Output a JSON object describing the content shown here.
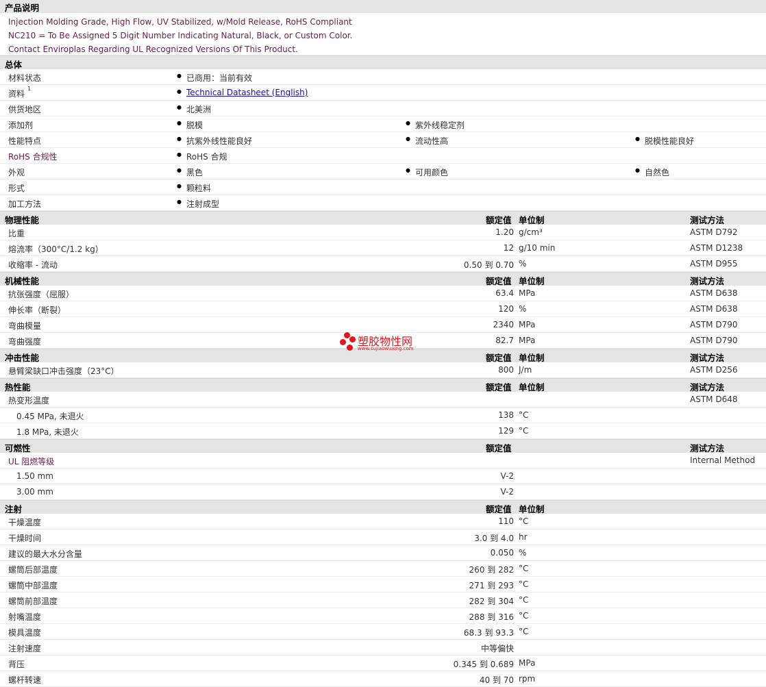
{
  "description": {
    "title": "产品说明",
    "lines": [
      "Injection Molding Grade, High Flow, UV Stabilized, w/Mold Release, RoHS Compliant",
      "NC210 = To Be Assigned 5 Digit Number Indicating Natural, Black, or Custom Color.",
      "Contact Enviroplas Regarding UL Recognized Versions Of This Product."
    ]
  },
  "general": {
    "title": "总体",
    "rows": [
      {
        "label": "材料状态",
        "v1": "已商用：当前有效"
      },
      {
        "label": "资料",
        "sup": "1",
        "v1": "Technical Datasheet (English)"
      },
      {
        "label": "供货地区",
        "v1": "北美洲"
      },
      {
        "label": "添加剂",
        "v1": "脱模",
        "v2": "紫外线稳定剂"
      },
      {
        "label": "性能特点",
        "v1": "抗紫外线性能良好",
        "v2": "流动性高",
        "v3": "脱模性能良好"
      },
      {
        "label": "RoHS 合规性",
        "v1": "RoHS 合规"
      },
      {
        "label": "外观",
        "v1": "黑色",
        "v2": "可用颜色",
        "v3": "自然色"
      },
      {
        "label": "形式",
        "v1": "颗粒料"
      },
      {
        "label": "加工方法",
        "v1": "注射成型"
      }
    ]
  },
  "headers": {
    "rated": "额定值",
    "unit": "单位制",
    "method": "测试方法"
  },
  "physical": {
    "title": "物理性能",
    "rows": [
      {
        "label": "比重",
        "value": "1.20",
        "unit": "g/cm³",
        "method": "ASTM D792"
      },
      {
        "label": "熔流率（300°C/1.2 kg）",
        "value": "12",
        "unit": "g/10 min",
        "method": "ASTM D1238"
      },
      {
        "label": "收缩率 - 流动",
        "value": "0.50 到  0.70",
        "unit": "%",
        "method": "ASTM D955"
      }
    ]
  },
  "mechanical": {
    "title": "机械性能",
    "rows": [
      {
        "label": "抗张强度（屈服）",
        "value": "63.4",
        "unit": "MPa",
        "method": "ASTM D638"
      },
      {
        "label": "伸长率（断裂）",
        "value": "120",
        "unit": "%",
        "method": "ASTM D638"
      },
      {
        "label": "弯曲模量",
        "value": "2340",
        "unit": "MPa",
        "method": "ASTM D790"
      },
      {
        "label": "弯曲强度",
        "value": "82.7",
        "unit": "MPa",
        "method": "ASTM D790"
      }
    ]
  },
  "impact": {
    "title": "冲击性能",
    "rows": [
      {
        "label": "悬臂梁缺口冲击强度（23°C）",
        "value": "800",
        "unit": "J/m",
        "method": "ASTM D256"
      }
    ]
  },
  "thermal": {
    "title": "热性能",
    "rows": [
      {
        "label": "热变形温度",
        "value": "",
        "unit": "",
        "method": "ASTM D648"
      },
      {
        "label": "0.45 MPa, 未退火",
        "value": "138",
        "unit": "°C",
        "method": "",
        "indent": true
      },
      {
        "label": "1.8 MPa, 未退火",
        "value": "129",
        "unit": "°C",
        "method": "",
        "indent": true
      }
    ]
  },
  "flammability": {
    "title": "可燃性",
    "rows": [
      {
        "label": "UL 阻燃等级",
        "value": "",
        "unit": "",
        "method": "Internal Method"
      },
      {
        "label": "1.50 mm",
        "value": "V-2",
        "unit": "",
        "method": "",
        "indent": true
      },
      {
        "label": "3.00 mm",
        "value": "V-2",
        "unit": "",
        "method": "",
        "indent": true
      }
    ]
  },
  "injection": {
    "title": "注射",
    "rows": [
      {
        "label": "干燥温度",
        "value": "110",
        "unit": "°C"
      },
      {
        "label": "干燥时间",
        "value": "3.0 到  4.0",
        "unit": "hr"
      },
      {
        "label": "建议的最大水分含量",
        "value": "0.050",
        "unit": "%"
      },
      {
        "label": "螺筒后部温度",
        "value": "260 到  282",
        "unit": "°C"
      },
      {
        "label": "螺筒中部温度",
        "value": "271 到  293",
        "unit": "°C"
      },
      {
        "label": "螺筒前部温度",
        "value": "282 到  304",
        "unit": "°C"
      },
      {
        "label": "射嘴温度",
        "value": "288 到  316",
        "unit": "°C"
      },
      {
        "label": "模具温度",
        "value": "68.3 到  93.3",
        "unit": "°C"
      },
      {
        "label": "注射速度",
        "value": "中等偏快",
        "unit": ""
      },
      {
        "label": "背压",
        "value": "0.345 到  0.689",
        "unit": "MPa"
      },
      {
        "label": "螺杆转速",
        "value": "40 到  70",
        "unit": "rpm"
      }
    ]
  },
  "watermark": {
    "text": "塑胶物性网",
    "url": "www.sujiaowuxing.com"
  }
}
